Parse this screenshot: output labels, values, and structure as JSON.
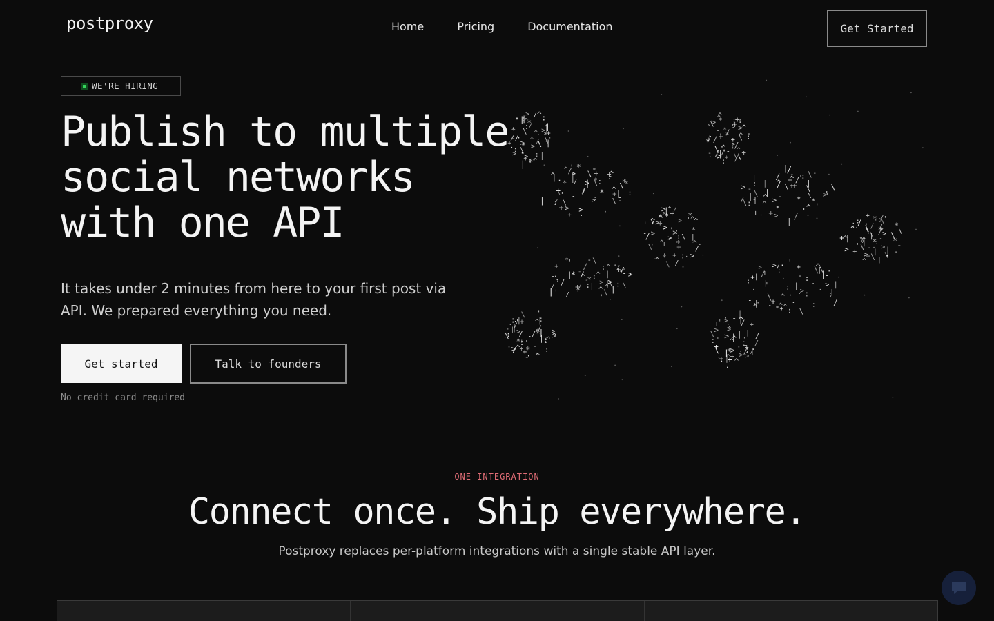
{
  "header": {
    "logo": "postproxy",
    "nav": [
      {
        "label": "Home"
      },
      {
        "label": "Pricing"
      },
      {
        "label": "Documentation"
      }
    ],
    "cta_label": "Get Started"
  },
  "hero": {
    "badge": "WE'RE HIRING",
    "title_lines": [
      "Publish to multiple",
      "social networks",
      "with one API"
    ],
    "subtitle": "It takes under 2 minutes from here to your first post via API. We prepared everything you need.",
    "primary_cta": "Get started",
    "secondary_cta": "Talk to founders",
    "note": "No credit card required"
  },
  "integration": {
    "eyebrow": "ONE INTEGRATION",
    "title": "Connect once. Ship everywhere.",
    "subtitle": "Postproxy replaces per-platform integrations with a single stable API layer."
  },
  "icons": {
    "badge_dot": "status-dot-icon",
    "chat": "chat-bubble-icon"
  },
  "colors": {
    "background": "#0c0c0c",
    "accent_eyebrow": "#e06c75",
    "hiring_dot": "#35d35a",
    "chat_widget": "#16203a"
  }
}
